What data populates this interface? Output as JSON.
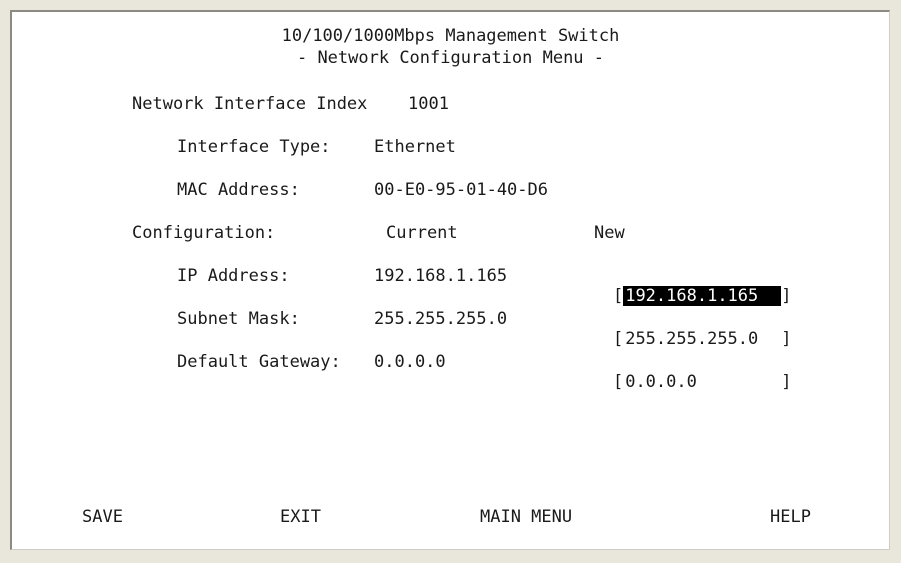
{
  "header": {
    "title": "10/100/1000Mbps Management Switch",
    "subtitle": "- Network Configuration Menu -"
  },
  "interface": {
    "index_label": "Network Interface Index",
    "index_value": "1001",
    "type_label": "Interface Type:",
    "type_value": "Ethernet",
    "mac_label": "MAC Address:",
    "mac_value": "00-E0-95-01-40-D6"
  },
  "config": {
    "label": "Configuration:",
    "current_header": "Current",
    "new_header": "New",
    "rows": [
      {
        "label": "IP Address:",
        "current": "192.168.1.165",
        "new": "192.168.1.165"
      },
      {
        "label": "Subnet Mask:",
        "current": "255.255.255.0",
        "new": "255.255.255.0"
      },
      {
        "label": "Default Gateway:",
        "current": "0.0.0.0",
        "new": "0.0.0.0"
      }
    ]
  },
  "commands": {
    "save": "SAVE",
    "exit": "EXIT",
    "main_menu": "MAIN MENU",
    "help": "HELP"
  },
  "colors": {
    "selection_bg": "#000000",
    "selection_fg": "#ffffff"
  }
}
